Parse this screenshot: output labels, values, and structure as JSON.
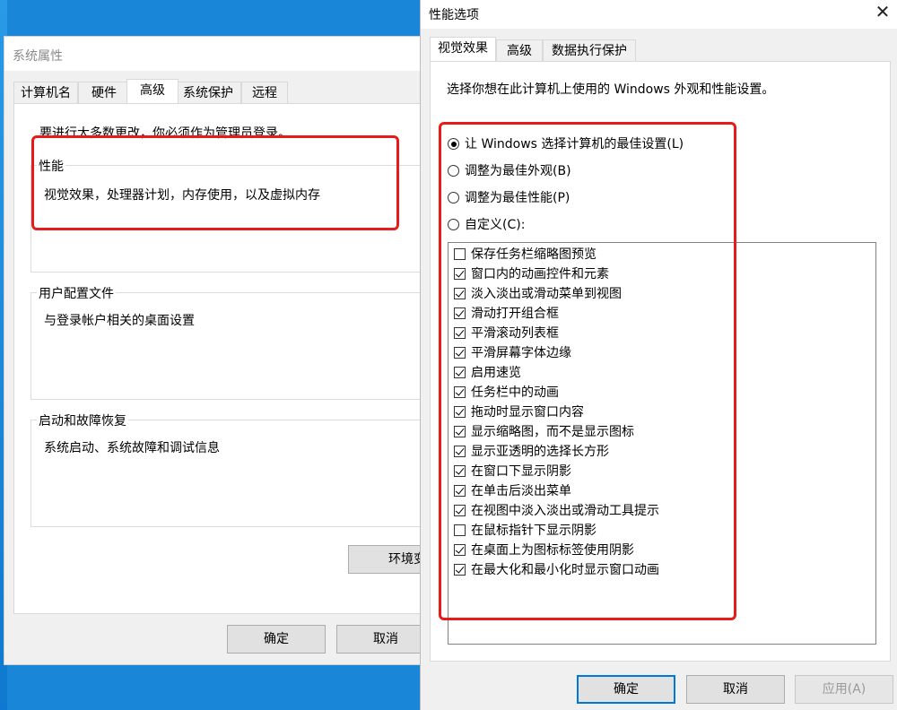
{
  "system_properties": {
    "title": "系统属性",
    "tabs": [
      "计算机名",
      "硬件",
      "高级",
      "系统保护",
      "远程"
    ],
    "active_tab": "高级",
    "admin_note": "要进行大多数更改，你必须作为管理员登录。",
    "groups": [
      {
        "label": "性能",
        "description": "视觉效果，处理器计划，内存使用，以及虚拟内存"
      },
      {
        "label": "用户配置文件",
        "description": "与登录帐户相关的桌面设置"
      },
      {
        "label": "启动和故障恢复",
        "description": "系统启动、系统故障和调试信息"
      }
    ],
    "env_button": "环境变",
    "ok_button": "确定",
    "cancel_button": "取消"
  },
  "performance_options": {
    "title": "性能选项",
    "close_glyph": "✕",
    "tabs": [
      "视觉效果",
      "高级",
      "数据执行保护"
    ],
    "active_tab": "视觉效果",
    "description": "选择你想在此计算机上使用的 Windows 外观和性能设置。",
    "radios": [
      {
        "label": "让 Windows 选择计算机的最佳设置(L)",
        "selected": true
      },
      {
        "label": "调整为最佳外观(B)",
        "selected": false
      },
      {
        "label": "调整为最佳性能(P)",
        "selected": false
      },
      {
        "label": "自定义(C):",
        "selected": false
      }
    ],
    "options": [
      {
        "label": "保存任务栏缩略图预览",
        "checked": false
      },
      {
        "label": "窗口内的动画控件和元素",
        "checked": true
      },
      {
        "label": "淡入淡出或滑动菜单到视图",
        "checked": true
      },
      {
        "label": "滑动打开组合框",
        "checked": true
      },
      {
        "label": "平滑滚动列表框",
        "checked": true
      },
      {
        "label": "平滑屏幕字体边缘",
        "checked": true
      },
      {
        "label": "启用速览",
        "checked": true
      },
      {
        "label": "任务栏中的动画",
        "checked": true
      },
      {
        "label": "拖动时显示窗口内容",
        "checked": true
      },
      {
        "label": "显示缩略图，而不是显示图标",
        "checked": true
      },
      {
        "label": "显示亚透明的选择长方形",
        "checked": true
      },
      {
        "label": "在窗口下显示阴影",
        "checked": true
      },
      {
        "label": "在单击后淡出菜单",
        "checked": true
      },
      {
        "label": "在视图中淡入淡出或滑动工具提示",
        "checked": true
      },
      {
        "label": "在鼠标指针下显示阴影",
        "checked": false
      },
      {
        "label": "在桌面上为图标标签使用阴影",
        "checked": true
      },
      {
        "label": "在最大化和最小化时显示窗口动画",
        "checked": true
      }
    ],
    "ok_button": "确定",
    "cancel_button": "取消",
    "apply_button": "应用(A)"
  },
  "colors": {
    "highlight_box": "#e81b1b",
    "accent": "#0078d7",
    "desktop": "#1a86d8"
  }
}
